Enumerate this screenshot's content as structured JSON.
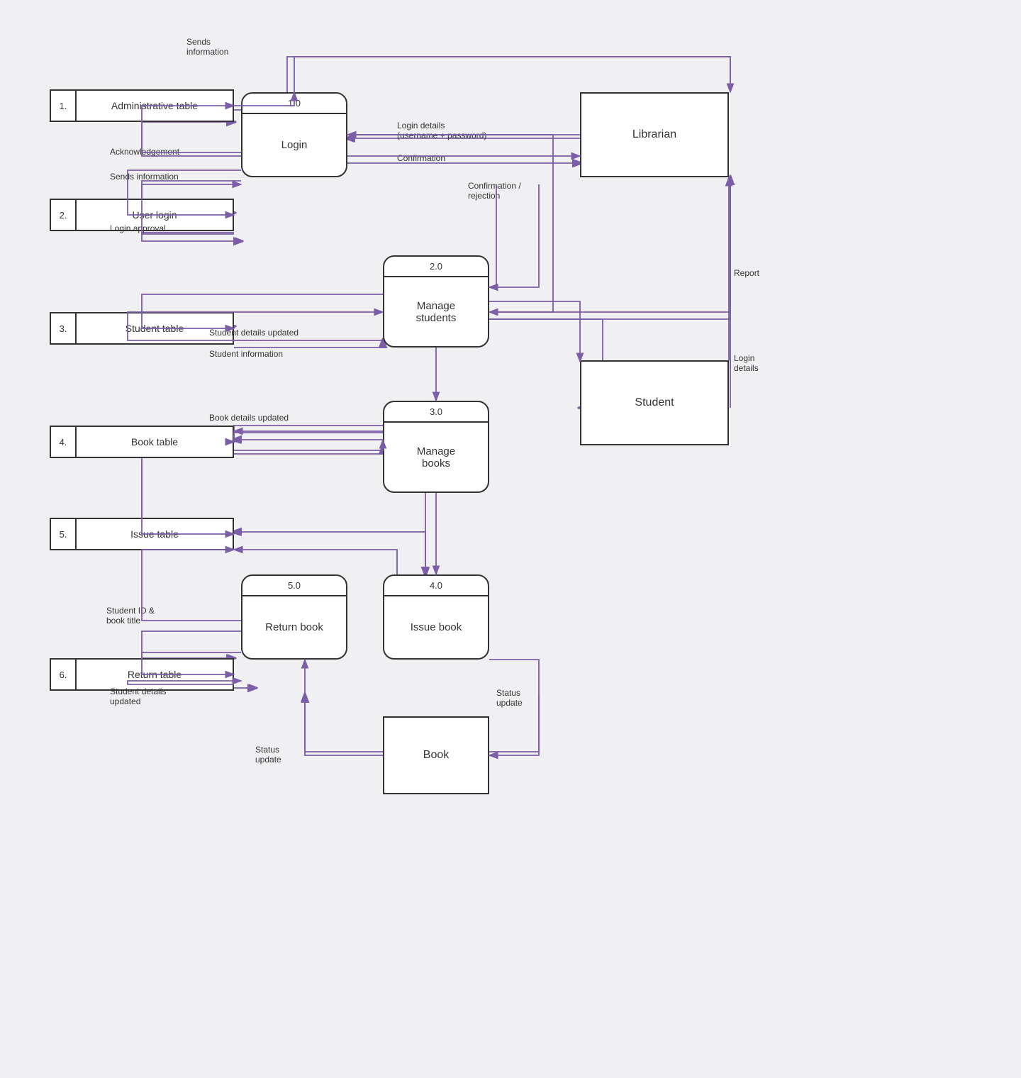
{
  "processes": {
    "login": {
      "id": "1.0",
      "label": "Login"
    },
    "manage_students": {
      "id": "2.0",
      "label": "Manage\nstudents"
    },
    "manage_books": {
      "id": "3.0",
      "label": "Manage\nbooks"
    },
    "return_book": {
      "id": "5.0",
      "label": "Return book"
    },
    "issue_book": {
      "id": "4.0",
      "label": "Issue book"
    }
  },
  "entities": {
    "librarian": {
      "label": "Librarian"
    },
    "student": {
      "label": "Student"
    },
    "book": {
      "label": "Book"
    }
  },
  "stores": {
    "admin_table": {
      "number": "1.",
      "label": "Administrative table"
    },
    "user_login": {
      "number": "2.",
      "label": "User login"
    },
    "student_table": {
      "number": "3.",
      "label": "Student table"
    },
    "book_table": {
      "number": "4.",
      "label": "Book table"
    },
    "issue_table": {
      "number": "5.",
      "label": "Issue table"
    },
    "return_table": {
      "number": "6.",
      "label": "Return table"
    }
  },
  "arrow_labels": {
    "sends_information": "Sends\ninformation",
    "acknowledgement": "Acknowledgement",
    "sends_info2": "Sends information",
    "login_approval": "Login approval",
    "login_details": "Login details\n(username + password)",
    "confirmation": "Confirmation",
    "confirmation_rejection": "Confirmation /\nrejection",
    "report": "Report",
    "login_details2": "Login\ndetails",
    "student_details_updated": "Student details updated",
    "student_information": "Student information",
    "book_details_updated": "Book details updated",
    "student_id_book_title": "Student ID &\nbook title",
    "student_details_updated2": "Student details\nupdated",
    "status_update": "Status\nupdate",
    "status_update2": "Status\nupdate"
  }
}
